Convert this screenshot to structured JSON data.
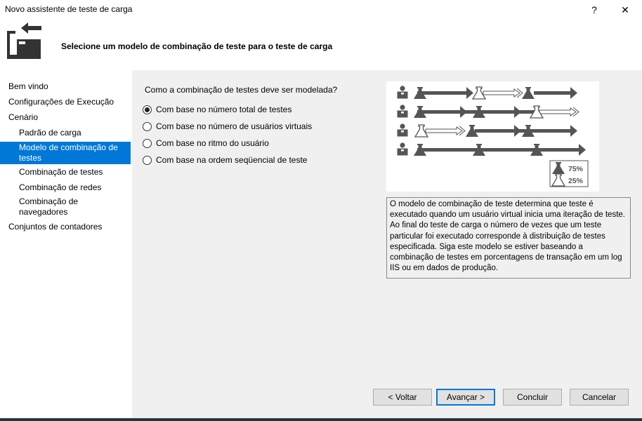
{
  "window": {
    "title": "Novo assistente de teste de carga",
    "help_label": "?",
    "close_label": "✕"
  },
  "header": {
    "icon": "wizard-arrow-folder-icon",
    "text": "Selecione um modelo de combinação de teste para o teste de carga"
  },
  "sidebar": {
    "items": [
      {
        "label": "Bem vindo",
        "selected": false
      },
      {
        "label": "Configurações de Execução",
        "selected": false
      },
      {
        "label": "Cenário",
        "selected": false
      },
      {
        "label": "Padrão de carga",
        "selected": false
      },
      {
        "label": "Modelo de combinação de testes",
        "selected": true
      },
      {
        "label": "Combinação de testes",
        "selected": false
      },
      {
        "label": "Combinação de redes",
        "selected": false
      },
      {
        "label": "Combinação de navegadores",
        "selected": false
      },
      {
        "label": "Conjuntos de contadores",
        "selected": false
      }
    ]
  },
  "main": {
    "question": "Como a combinação de testes deve ser modelada?",
    "options": [
      {
        "label": "Com base no número total de testes",
        "checked": true
      },
      {
        "label": "Com base no número de usuários virtuais",
        "checked": false
      },
      {
        "label": "Com base no ritmo do usuário",
        "checked": false
      },
      {
        "label": "Com base na ordem seqüencial de teste",
        "checked": false
      }
    ],
    "diagram": {
      "legend": [
        {
          "icon": "filled-flask-icon",
          "value": "75%"
        },
        {
          "icon": "outline-flask-icon",
          "value": "25%"
        }
      ]
    },
    "description": "O modelo de combinação de teste determina que teste é executado quando um usuário virtual inicia uma iteração de teste. Ao final do teste de carga o número de vezes que um teste particular foi executado corresponde à distribuição de testes especificada. Siga este modelo se estiver baseando a combinação de testes em porcentagens de transação em um log IIS ou em dados de produção."
  },
  "footer": {
    "back": "< Voltar",
    "next": "Avançar >",
    "finish": "Concluir",
    "cancel": "Cancelar"
  },
  "colors": {
    "selection": "#0078d7",
    "panel": "#f0f0f0",
    "diagram_dark": "#555555"
  }
}
